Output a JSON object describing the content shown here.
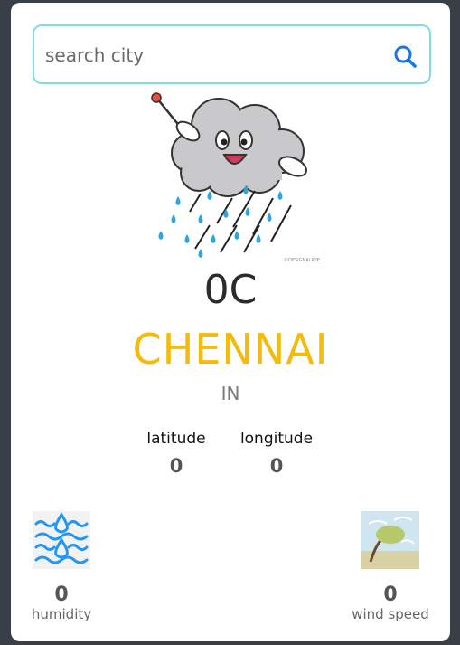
{
  "search": {
    "placeholder": "search city",
    "value": ""
  },
  "weather": {
    "icon": "rain-cloud-icon",
    "watermark": "©DESIGNALIKIE",
    "temperature": "0C",
    "city": "CHENNAI",
    "country": "IN"
  },
  "coordinates": {
    "latitude_label": "latitude",
    "latitude_value": "0",
    "longitude_label": "longitude",
    "longitude_value": "0"
  },
  "stats": {
    "humidity_value": "0",
    "humidity_label": "humidity",
    "humidity_icon": "humidity-icon",
    "wind_value": "0",
    "wind_label": "wind speed",
    "wind_icon": "wind-icon"
  },
  "colors": {
    "city": "#f5bb0a",
    "search_border": "#7fdcea",
    "search_icon": "#1a73e8",
    "water": "#2196f3"
  }
}
